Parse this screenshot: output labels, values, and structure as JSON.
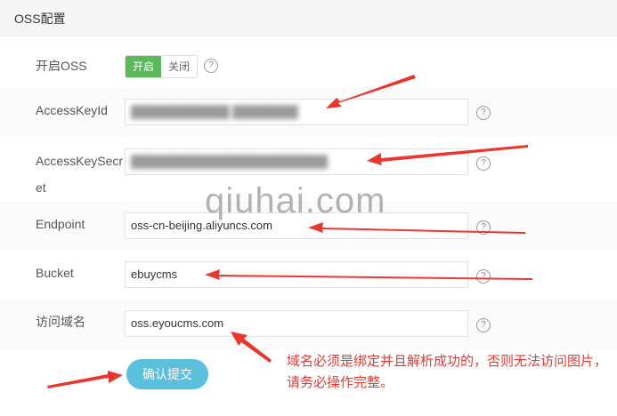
{
  "panel": {
    "title": "OSS配置"
  },
  "toggle": {
    "label": "开启OSS",
    "on": "开启",
    "off": "关闭"
  },
  "fields": [
    {
      "label": "AccessKeyId",
      "value": "████████████ ████████"
    },
    {
      "label_line1": "AccessKeySecr",
      "label_line2": "et",
      "value": "████████████████████████"
    },
    {
      "label": "Endpoint",
      "value": "oss-cn-beijing.aliyuncs.com"
    },
    {
      "label": "Bucket",
      "value": "ebuycms"
    },
    {
      "label": "访问域名",
      "value": "oss.eyoucms.com"
    }
  ],
  "help_icon": "?",
  "submit_label": "确认提交",
  "watermark": "qiuhai.com",
  "note": "域名必须是绑定并且解析成功的，否则无法访问图片，请务必操作完整。",
  "colors": {
    "arrow": "#e8372f",
    "toggle_on": "#5cb85c",
    "submit": "#5bc0de"
  }
}
